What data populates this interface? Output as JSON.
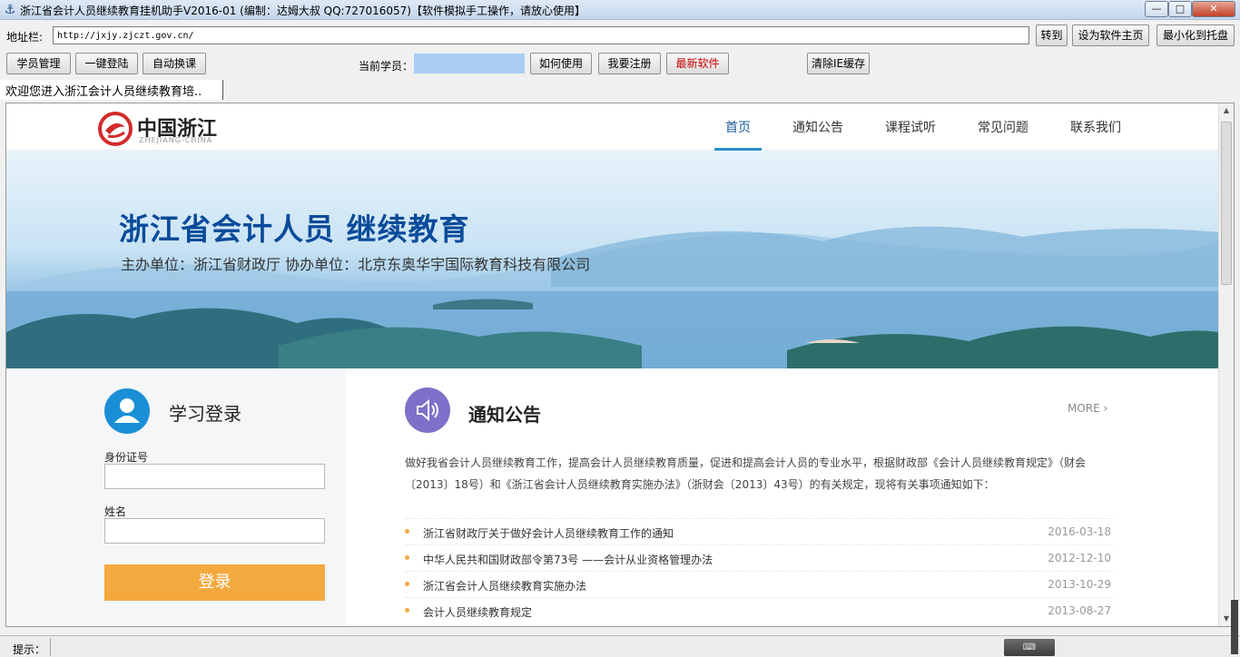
{
  "window": {
    "title": "浙江省会计人员继续教育挂机助手V2016-01 (编制：达姆大叔 QQ:727016057)【软件模拟手工操作，请放心使用】",
    "minimize": "—",
    "maximize": "□",
    "close": "✕"
  },
  "address_bar": {
    "label": "地址栏:",
    "url": "http://jxjy.zjczt.gov.cn/",
    "go_button": "转到",
    "set_home_button": "设为软件主页",
    "minimize_tray_button": "最小化到托盘"
  },
  "toolbar": {
    "student_mgmt": "学员管理",
    "one_click_login": "一键登陆",
    "auto_switch": "自动换课",
    "current_student_label": "当前学员：",
    "current_student_value": "",
    "how_to_use": "如何使用",
    "register": "我要注册",
    "latest_software": "最新软件",
    "clear_cache": "清除IE缓存"
  },
  "welcome_text": "欢迎您进入浙江会计人员继续教育培..",
  "site": {
    "logo_text": "中国浙江",
    "logo_sub": "ZHEJIANG-CHINA",
    "nav": [
      {
        "label": "首页"
      },
      {
        "label": "通知公告"
      },
      {
        "label": "课程试听"
      },
      {
        "label": "常见问题"
      },
      {
        "label": "联系我们"
      }
    ],
    "banner_title": "浙江省会计人员 继续教育",
    "banner_sub": "主办单位：浙江省财政厅    协办单位：北京东奥华宇国际教育科技有限公司",
    "login": {
      "title": "学习登录",
      "id_label": "身份证号",
      "id_value": "",
      "name_label": "姓名",
      "name_value": "",
      "submit": "登录"
    },
    "news": {
      "title": "通知公告",
      "more": "MORE ›",
      "intro": "做好我省会计人员继续教育工作，提高会计人员继续教育质量，促进和提高会计人员的专业水平，根据财政部《会计人员继续教育规定》（财会〔2013〕18号）和《浙江省会计人员继续教育实施办法》（浙财会〔2013〕43号）的有关规定，现将有关事项通知如下：",
      "items": [
        {
          "title": "浙江省财政厅关于做好会计人员继续教育工作的通知",
          "date": "2016-03-18"
        },
        {
          "title": "中华人民共和国财政部令第73号 ——会计从业资格管理办法",
          "date": "2012-12-10"
        },
        {
          "title": "浙江省会计人员继续教育实施办法",
          "date": "2013-10-29"
        },
        {
          "title": "会计人员继续教育规定",
          "date": "2013-08-27"
        }
      ]
    }
  },
  "status": {
    "label": "提示：",
    "value": ""
  },
  "colors": {
    "nav_active": "#2b8fd1",
    "login_button": "#f4a93e",
    "avatar_bg": "#1a8fd6",
    "news_icon_bg": "#7f6fc8",
    "banner_title": "#0a4b9a",
    "latest_software_text": "#cc0000"
  },
  "icons": {
    "app": "anchor-icon",
    "avatar": "user-icon",
    "news": "speaker-icon",
    "logo": "zhejiang-logo-icon"
  }
}
